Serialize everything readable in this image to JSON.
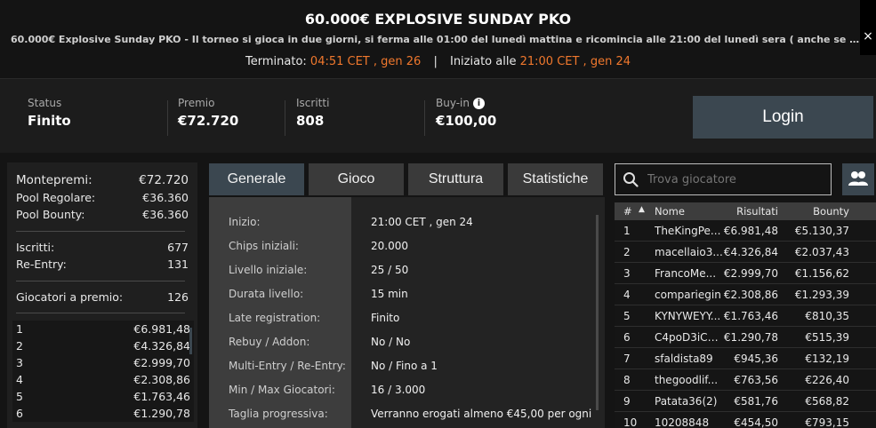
{
  "header": {
    "title": "60.000€ EXPLOSIVE SUNDAY PKO",
    "subtitle": "60.000€ Explosive Sunday PKO - Il torneo si gioca in due giorni, si ferma alle 01:00 del lunedì mattina e ricomincia alle 21:00 del lunedì sera ( anche se la ...",
    "ended_label": "Terminato:",
    "ended_value": "04:51 CET , gen 26",
    "separator": "|",
    "started_label": "Iniziato alle",
    "started_value": "21:00 CET , gen 24",
    "close_icon": "×"
  },
  "stats": {
    "status_label": "Status",
    "status_value": "Finito",
    "prize_label": "Premio",
    "prize_value": "€72.720",
    "entrants_label": "Iscritti",
    "entrants_value": "808",
    "buyin_label": "Buy-in",
    "buyin_value": "€100,00",
    "info_icon": "i"
  },
  "login_label": "Login",
  "summary": {
    "montepremi_label": "Montepremi:",
    "montepremi_value": "€72.720",
    "pool_regolare_label": "Pool Regolare:",
    "pool_regolare_value": "€36.360",
    "pool_bounty_label": "Pool Bounty:",
    "pool_bounty_value": "€36.360",
    "iscritti_label": "Iscritti:",
    "iscritti_value": "677",
    "reentry_label": "Re-Entry:",
    "reentry_value": "131",
    "giocatori_label": "Giocatori a premio:",
    "giocatori_value": "126",
    "prizes": [
      {
        "pos": "1",
        "amount": "€6.981,48"
      },
      {
        "pos": "2",
        "amount": "€4.326,84"
      },
      {
        "pos": "3",
        "amount": "€2.999,70"
      },
      {
        "pos": "4",
        "amount": "€2.308,86"
      },
      {
        "pos": "5",
        "amount": "€1.763,46"
      },
      {
        "pos": "6",
        "amount": "€1.290,78"
      }
    ]
  },
  "tabs": [
    "Generale",
    "Gioco",
    "Struttura",
    "Statistiche"
  ],
  "details": [
    {
      "label": "Inizio:",
      "value": "21:00 CET , gen 24"
    },
    {
      "label": "Chips iniziali:",
      "value": "20.000"
    },
    {
      "label": "Livello iniziale:",
      "value": "25 / 50"
    },
    {
      "label": "Durata livello:",
      "value": "15 min"
    },
    {
      "label": "Late registration:",
      "value": "Finito"
    },
    {
      "label": "Rebuy / Addon:",
      "value": "No / No"
    },
    {
      "label": "Multi-Entry / Re-Entry:",
      "value": "No / Fino a 1"
    },
    {
      "label": "Min / Max Giocatori:",
      "value": "16 / 3.000"
    },
    {
      "label": "Taglia progressiva:",
      "value": "Verranno erogati almeno €45,00 per ogni"
    }
  ],
  "search": {
    "placeholder": "Trova giocatore"
  },
  "players_table": {
    "headers": {
      "num": "#",
      "sort": "▲",
      "name": "Nome",
      "results": "Risultati",
      "bounty": "Bounty"
    },
    "rows": [
      {
        "num": "1",
        "name": "TheKingPe...",
        "results": "€6.981,48",
        "bounty": "€5.130,37"
      },
      {
        "num": "2",
        "name": "macellaio3...",
        "results": "€4.326,84",
        "bounty": "€2.037,43"
      },
      {
        "num": "3",
        "name": "FrancoMe...",
        "results": "€2.999,70",
        "bounty": "€1.156,62"
      },
      {
        "num": "4",
        "name": "compariegin",
        "results": "€2.308,86",
        "bounty": "€1.293,39"
      },
      {
        "num": "5",
        "name": "KYNYWEYY...",
        "results": "€1.763,46",
        "bounty": "€810,35"
      },
      {
        "num": "6",
        "name": "C4poD3iC4...",
        "results": "€1.290,78",
        "bounty": "€515,39"
      },
      {
        "num": "7",
        "name": "sfaldista89",
        "results": "€945,36",
        "bounty": "€132,19"
      },
      {
        "num": "8",
        "name": "thegoodlif...",
        "results": "€763,56",
        "bounty": "€226,40"
      },
      {
        "num": "9",
        "name": "Patata36(2)",
        "results": "€581,76",
        "bounty": "€568,82"
      },
      {
        "num": "10",
        "name": "10208848",
        "results": "€454,50",
        "bounty": "€793,15"
      }
    ]
  }
}
